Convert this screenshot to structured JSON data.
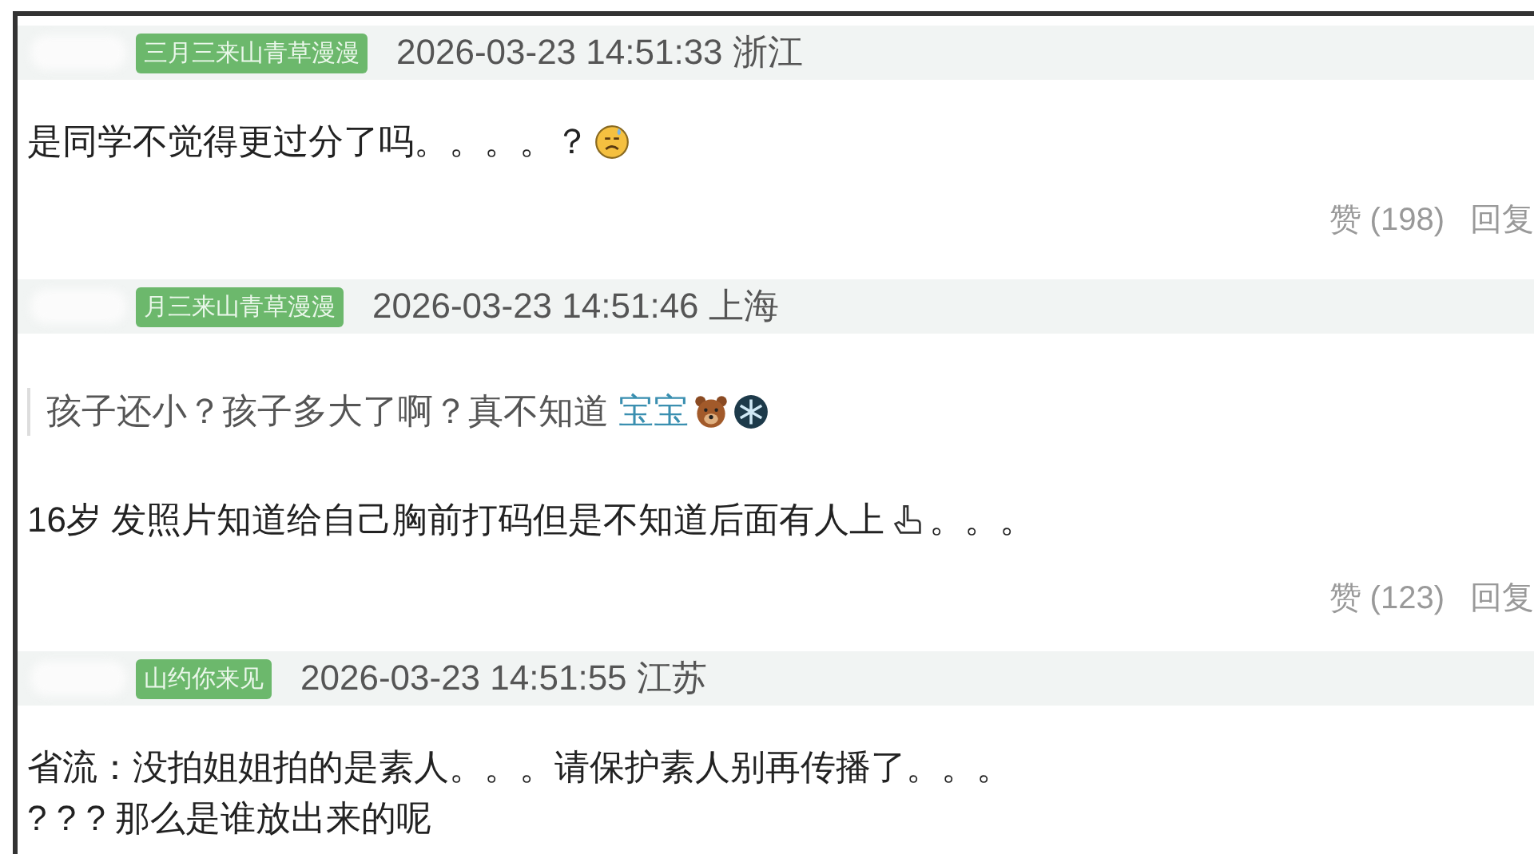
{
  "comments": [
    {
      "user_tag": "三月三来山青草漫漫",
      "meta": "2026-03-23 14:51:33 浙江",
      "blocks": [
        {
          "kind": "text",
          "text": "是同学不觉得更过分了吗。。。。？",
          "icons": [
            {
              "kind": "sad-face"
            }
          ]
        }
      ],
      "likes": "赞 (198)",
      "reply": "回复"
    },
    {
      "user_tag": "月三来山青草漫漫",
      "meta": "2026-03-23 14:51:46 上海",
      "blocks": [
        {
          "kind": "quote",
          "text": "孩子还小？孩子多大了啊？真不知道 ",
          "link": "宝宝",
          "icons": [
            {
              "kind": "bear"
            },
            {
              "kind": "snowflake"
            }
          ]
        },
        {
          "kind": "text",
          "text": "16岁 发照片知道给自己胸前打码但是不知道后面有人上",
          "icons": [
            {
              "kind": "hand"
            }
          ],
          "after": "。。。"
        }
      ],
      "likes": "赞 (123)",
      "reply": "回复"
    },
    {
      "user_tag": "山约你来见",
      "meta": "2026-03-23 14:51:55 江苏",
      "blocks": [
        {
          "kind": "text",
          "text": "省流：没拍姐姐拍的是素人。。。请保护素人别再传播了。。。"
        },
        {
          "kind": "text",
          "text": "? ? ? 那么是谁放出来的呢"
        }
      ]
    }
  ]
}
